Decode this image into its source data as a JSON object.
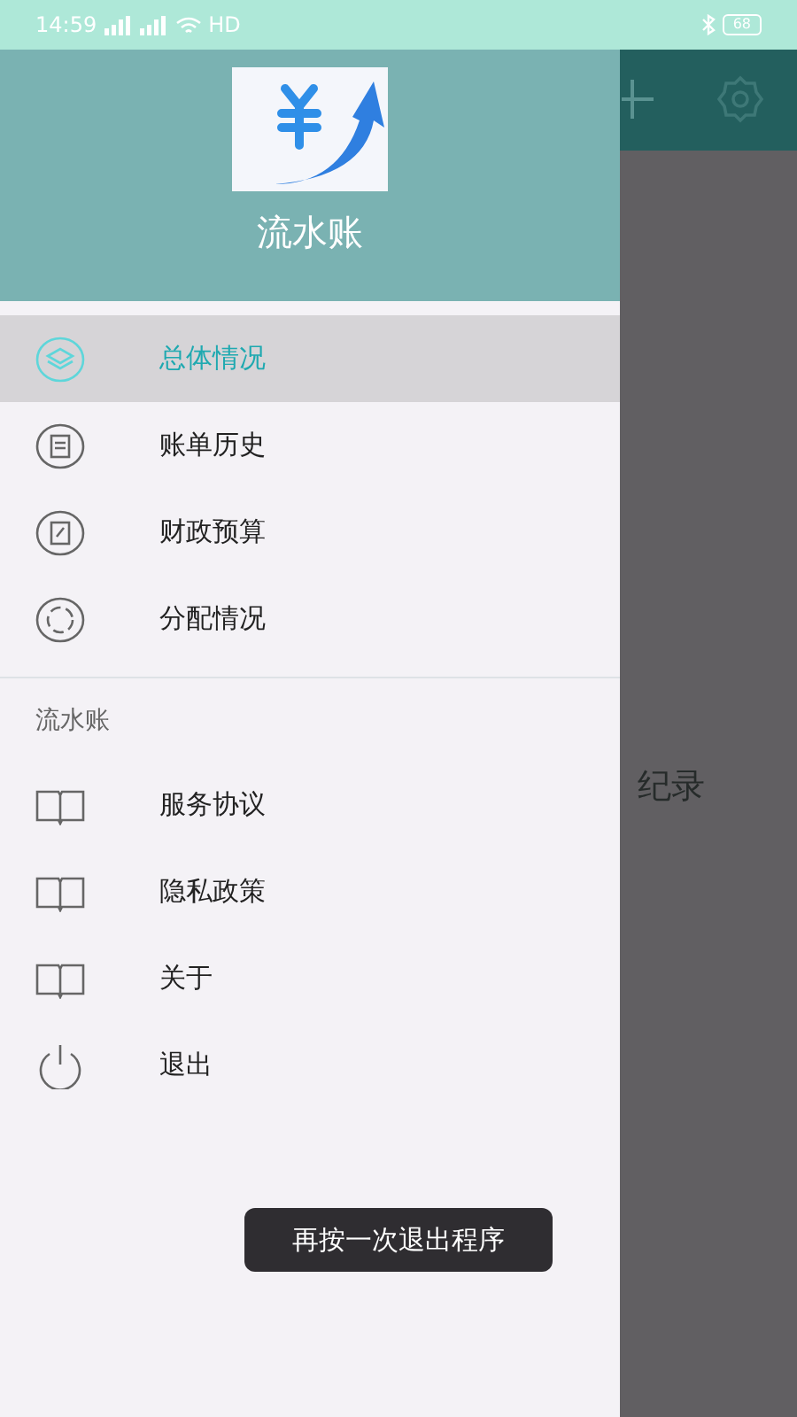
{
  "status_bar": {
    "time": "14:59",
    "network": "HD",
    "battery": "68"
  },
  "app_bar": {
    "behind_text": "纪录"
  },
  "drawer": {
    "title": "流水账",
    "menu": [
      {
        "label": "总体情况",
        "kind": "layers",
        "selected": true
      },
      {
        "label": "账单历史",
        "kind": "document",
        "selected": false
      },
      {
        "label": "财政预算",
        "kind": "edit",
        "selected": false
      },
      {
        "label": "分配情况",
        "kind": "cycle",
        "selected": false
      }
    ],
    "section_title": "流水账",
    "links": [
      {
        "label": "服务协议",
        "kind": "book"
      },
      {
        "label": "隐私政策",
        "kind": "book"
      },
      {
        "label": "关于",
        "kind": "book"
      },
      {
        "label": "退出",
        "kind": "power"
      }
    ]
  },
  "toast": "再按一次退出程序"
}
